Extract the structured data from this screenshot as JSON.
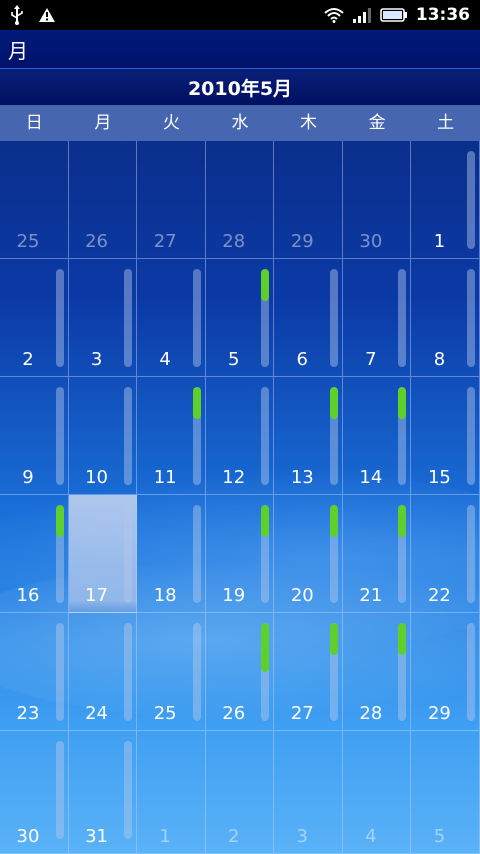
{
  "status_bar": {
    "left_icons": [
      "usb-icon",
      "warning-icon"
    ],
    "right_icons": [
      "wifi-icon",
      "signal-icon",
      "battery-icon"
    ],
    "time": "13:36"
  },
  "title_bar": {
    "title": "月"
  },
  "calendar": {
    "month_label": "2010年5月",
    "weekdays": [
      "日",
      "月",
      "火",
      "水",
      "木",
      "金",
      "土"
    ],
    "colors": {
      "event_indicator": "#5fcf2a",
      "today_highlight": "#c8d7f0"
    },
    "weeks": [
      [
        {
          "day": "25",
          "in_month": false,
          "has_track": false,
          "event_fill": 0
        },
        {
          "day": "26",
          "in_month": false,
          "has_track": false,
          "event_fill": 0
        },
        {
          "day": "27",
          "in_month": false,
          "has_track": false,
          "event_fill": 0
        },
        {
          "day": "28",
          "in_month": false,
          "has_track": false,
          "event_fill": 0
        },
        {
          "day": "29",
          "in_month": false,
          "has_track": false,
          "event_fill": 0
        },
        {
          "day": "30",
          "in_month": false,
          "has_track": false,
          "event_fill": 0
        },
        {
          "day": "1",
          "in_month": true,
          "has_track": true,
          "event_fill": 0
        }
      ],
      [
        {
          "day": "2",
          "in_month": true,
          "has_track": true,
          "event_fill": 0
        },
        {
          "day": "3",
          "in_month": true,
          "has_track": true,
          "event_fill": 0
        },
        {
          "day": "4",
          "in_month": true,
          "has_track": true,
          "event_fill": 0
        },
        {
          "day": "5",
          "in_month": true,
          "has_track": true,
          "event_fill": 0.33
        },
        {
          "day": "6",
          "in_month": true,
          "has_track": true,
          "event_fill": 0
        },
        {
          "day": "7",
          "in_month": true,
          "has_track": true,
          "event_fill": 0
        },
        {
          "day": "8",
          "in_month": true,
          "has_track": true,
          "event_fill": 0
        }
      ],
      [
        {
          "day": "9",
          "in_month": true,
          "has_track": true,
          "event_fill": 0
        },
        {
          "day": "10",
          "in_month": true,
          "has_track": true,
          "event_fill": 0
        },
        {
          "day": "11",
          "in_month": true,
          "has_track": true,
          "event_fill": 0.33
        },
        {
          "day": "12",
          "in_month": true,
          "has_track": true,
          "event_fill": 0
        },
        {
          "day": "13",
          "in_month": true,
          "has_track": true,
          "event_fill": 0.33
        },
        {
          "day": "14",
          "in_month": true,
          "has_track": true,
          "event_fill": 0.33
        },
        {
          "day": "15",
          "in_month": true,
          "has_track": true,
          "event_fill": 0
        }
      ],
      [
        {
          "day": "16",
          "in_month": true,
          "has_track": true,
          "event_fill": 0.33
        },
        {
          "day": "17",
          "in_month": true,
          "has_track": true,
          "event_fill": 0,
          "today": true
        },
        {
          "day": "18",
          "in_month": true,
          "has_track": true,
          "event_fill": 0
        },
        {
          "day": "19",
          "in_month": true,
          "has_track": true,
          "event_fill": 0.33
        },
        {
          "day": "20",
          "in_month": true,
          "has_track": true,
          "event_fill": 0.33
        },
        {
          "day": "21",
          "in_month": true,
          "has_track": true,
          "event_fill": 0.33
        },
        {
          "day": "22",
          "in_month": true,
          "has_track": true,
          "event_fill": 0
        }
      ],
      [
        {
          "day": "23",
          "in_month": true,
          "has_track": true,
          "event_fill": 0
        },
        {
          "day": "24",
          "in_month": true,
          "has_track": true,
          "event_fill": 0
        },
        {
          "day": "25",
          "in_month": true,
          "has_track": true,
          "event_fill": 0
        },
        {
          "day": "26",
          "in_month": true,
          "has_track": true,
          "event_fill": 0.5
        },
        {
          "day": "27",
          "in_month": true,
          "has_track": true,
          "event_fill": 0.33
        },
        {
          "day": "28",
          "in_month": true,
          "has_track": true,
          "event_fill": 0.33
        },
        {
          "day": "29",
          "in_month": true,
          "has_track": true,
          "event_fill": 0
        }
      ],
      [
        {
          "day": "30",
          "in_month": true,
          "has_track": true,
          "event_fill": 0
        },
        {
          "day": "31",
          "in_month": true,
          "has_track": true,
          "event_fill": 0
        },
        {
          "day": "1",
          "in_month": false,
          "has_track": false,
          "event_fill": 0
        },
        {
          "day": "2",
          "in_month": false,
          "has_track": false,
          "event_fill": 0
        },
        {
          "day": "3",
          "in_month": false,
          "has_track": false,
          "event_fill": 0
        },
        {
          "day": "4",
          "in_month": false,
          "has_track": false,
          "event_fill": 0
        },
        {
          "day": "5",
          "in_month": false,
          "has_track": false,
          "event_fill": 0
        }
      ]
    ]
  }
}
